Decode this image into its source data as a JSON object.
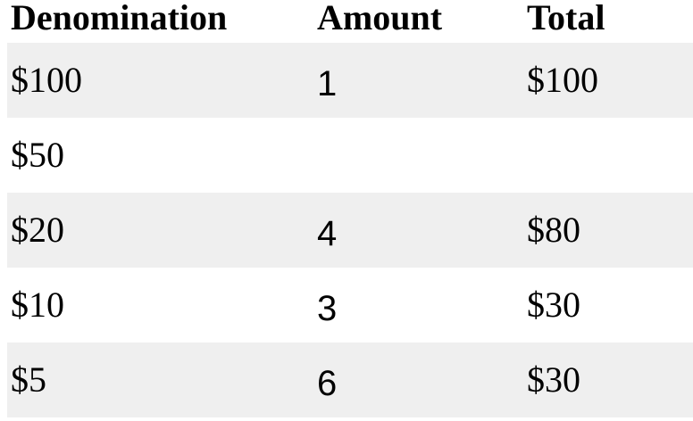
{
  "table": {
    "headers": {
      "denomination": "Denomination",
      "amount": "Amount",
      "total": "Total"
    },
    "rows": [
      {
        "denomination": "$100",
        "amount": "1",
        "total": "$100",
        "shaded": true
      },
      {
        "denomination": "$50",
        "amount": "",
        "total": "",
        "shaded": false
      },
      {
        "denomination": "$20",
        "amount": "4",
        "total": "$80",
        "shaded": true
      },
      {
        "denomination": "$10",
        "amount": "3",
        "total": "$30",
        "shaded": false
      },
      {
        "denomination": "$5",
        "amount": "6",
        "total": "$30",
        "shaded": true
      }
    ]
  },
  "colors": {
    "shaded_row": "#efefef",
    "background": "#ffffff",
    "text": "#000000"
  }
}
